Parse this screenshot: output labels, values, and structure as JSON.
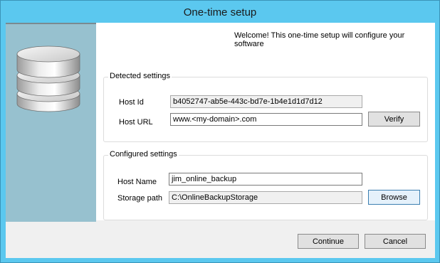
{
  "window": {
    "title": "One-time setup"
  },
  "welcome_text": "Welcome! This one-time setup will configure your software",
  "detected": {
    "legend": "Detected settings",
    "host_id_label": "Host Id",
    "host_id_value": "b4052747-ab5e-443c-bd7e-1b4e1d1d7d12",
    "host_url_label": "Host URL",
    "host_url_value": "www.<my-domain>.com",
    "verify_label": "Verify"
  },
  "configured": {
    "legend": "Configured settings",
    "host_name_label": "Host Name",
    "host_name_value": "jim_online_backup",
    "storage_label": "Storage path",
    "storage_value": "C:\\OnlineBackupStorage",
    "browse_label": "Browse"
  },
  "footer": {
    "continue_label": "Continue",
    "cancel_label": "Cancel"
  },
  "icons": {
    "side": "database-icon"
  }
}
